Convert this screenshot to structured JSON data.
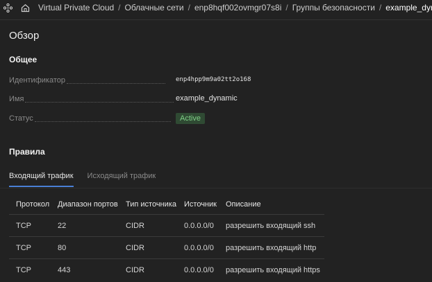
{
  "breadcrumbs": [
    {
      "label": "Virtual Private Cloud"
    },
    {
      "label": "Облачные сети"
    },
    {
      "label": "enp8hqf002ovmgr07s8i"
    },
    {
      "label": "Группы безопасности"
    },
    {
      "label": "example_dynamic"
    }
  ],
  "page_title": "Обзор",
  "general": {
    "title": "Общее",
    "id_label": "Идентификатор",
    "id_value": "enp4hpp9m9a02tt2o168",
    "name_label": "Имя",
    "name_value": "example_dynamic",
    "status_label": "Статус",
    "status_value": "Active"
  },
  "rules": {
    "title": "Правила",
    "tabs": [
      {
        "label": "Входящий трафик",
        "active": true
      },
      {
        "label": "Исходящий трафик",
        "active": false
      }
    ],
    "columns": [
      "Протокол",
      "Диапазон портов",
      "Тип источника",
      "Источник",
      "Описание"
    ],
    "rows": [
      [
        "TCP",
        "22",
        "CIDR",
        "0.0.0.0/0",
        "разрешить входящий ssh"
      ],
      [
        "TCP",
        "80",
        "CIDR",
        "0.0.0.0/0",
        "разрешить входящий http"
      ],
      [
        "TCP",
        "443",
        "CIDR",
        "0.0.0.0/0",
        "разрешить входящий https"
      ]
    ]
  },
  "colors": {
    "background": "#222222",
    "accent": "#4a7fd6",
    "status_badge_bg": "#2f4a33",
    "status_badge_text": "#7fcf86"
  },
  "icons": [
    "network-icon",
    "home-icon"
  ]
}
